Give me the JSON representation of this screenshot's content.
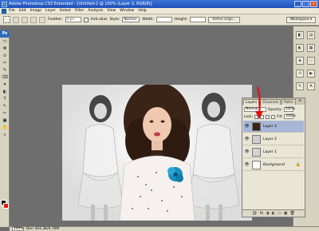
{
  "window": {
    "title": "Adobe Photoshop CS3 Extended - [Untitled-2 @ 100% (Layer 3, RGB/8)]",
    "app_icon": "Ps",
    "controls": [
      "_",
      "□",
      "x"
    ]
  },
  "menu": {
    "items": [
      "File",
      "Edit",
      "Image",
      "Layer",
      "Select",
      "Filter",
      "Analysis",
      "View",
      "Window",
      "Help"
    ],
    "workspace_label": "Workspace ▾"
  },
  "options_bar": {
    "feather_label": "Feather:",
    "feather_value": "0 px",
    "antialias_label": "Anti-alias",
    "style_label": "Style:",
    "style_value": "Normal",
    "width_label": "Width:",
    "height_label": "Height:",
    "refine_button": "Refine Edge...",
    "workspace_button": "Workspace ▾"
  },
  "toolbox": {
    "header": "Ps",
    "tools": [
      "▭",
      "✥",
      "⊙",
      "✂",
      "✎",
      "⌫",
      "✦",
      "◐",
      "T",
      "↖",
      "✏",
      "▣",
      "✋",
      "⌕"
    ],
    "foreground_color": "#000000",
    "background_color": "#e81818"
  },
  "layers_panel": {
    "tabs": [
      "Layers",
      "Channels",
      "Paths"
    ],
    "menu_icon": "≡",
    "blend_mode": "Normal",
    "opacity_label": "Opacity:",
    "opacity_value": "100%",
    "lock_label": "Lock:",
    "fill_label": "Fill:",
    "fill_value": "100%",
    "layers": [
      {
        "name": "Layer 3",
        "selected": true,
        "visible": true
      },
      {
        "name": "Layer 2",
        "selected": false,
        "visible": true
      },
      {
        "name": "Layer 1",
        "selected": false,
        "visible": true
      },
      {
        "name": "Background",
        "selected": false,
        "visible": true,
        "locked": true
      }
    ],
    "footer_icons": [
      "⛓",
      "fx",
      "◑",
      "◐",
      "▭",
      "▣",
      "🗑"
    ]
  },
  "status_bar": {
    "zoom": "100%",
    "doc_info": "Doc: 831.3K/4.76M"
  },
  "annotation": {
    "arrow_color": "#e01010"
  }
}
